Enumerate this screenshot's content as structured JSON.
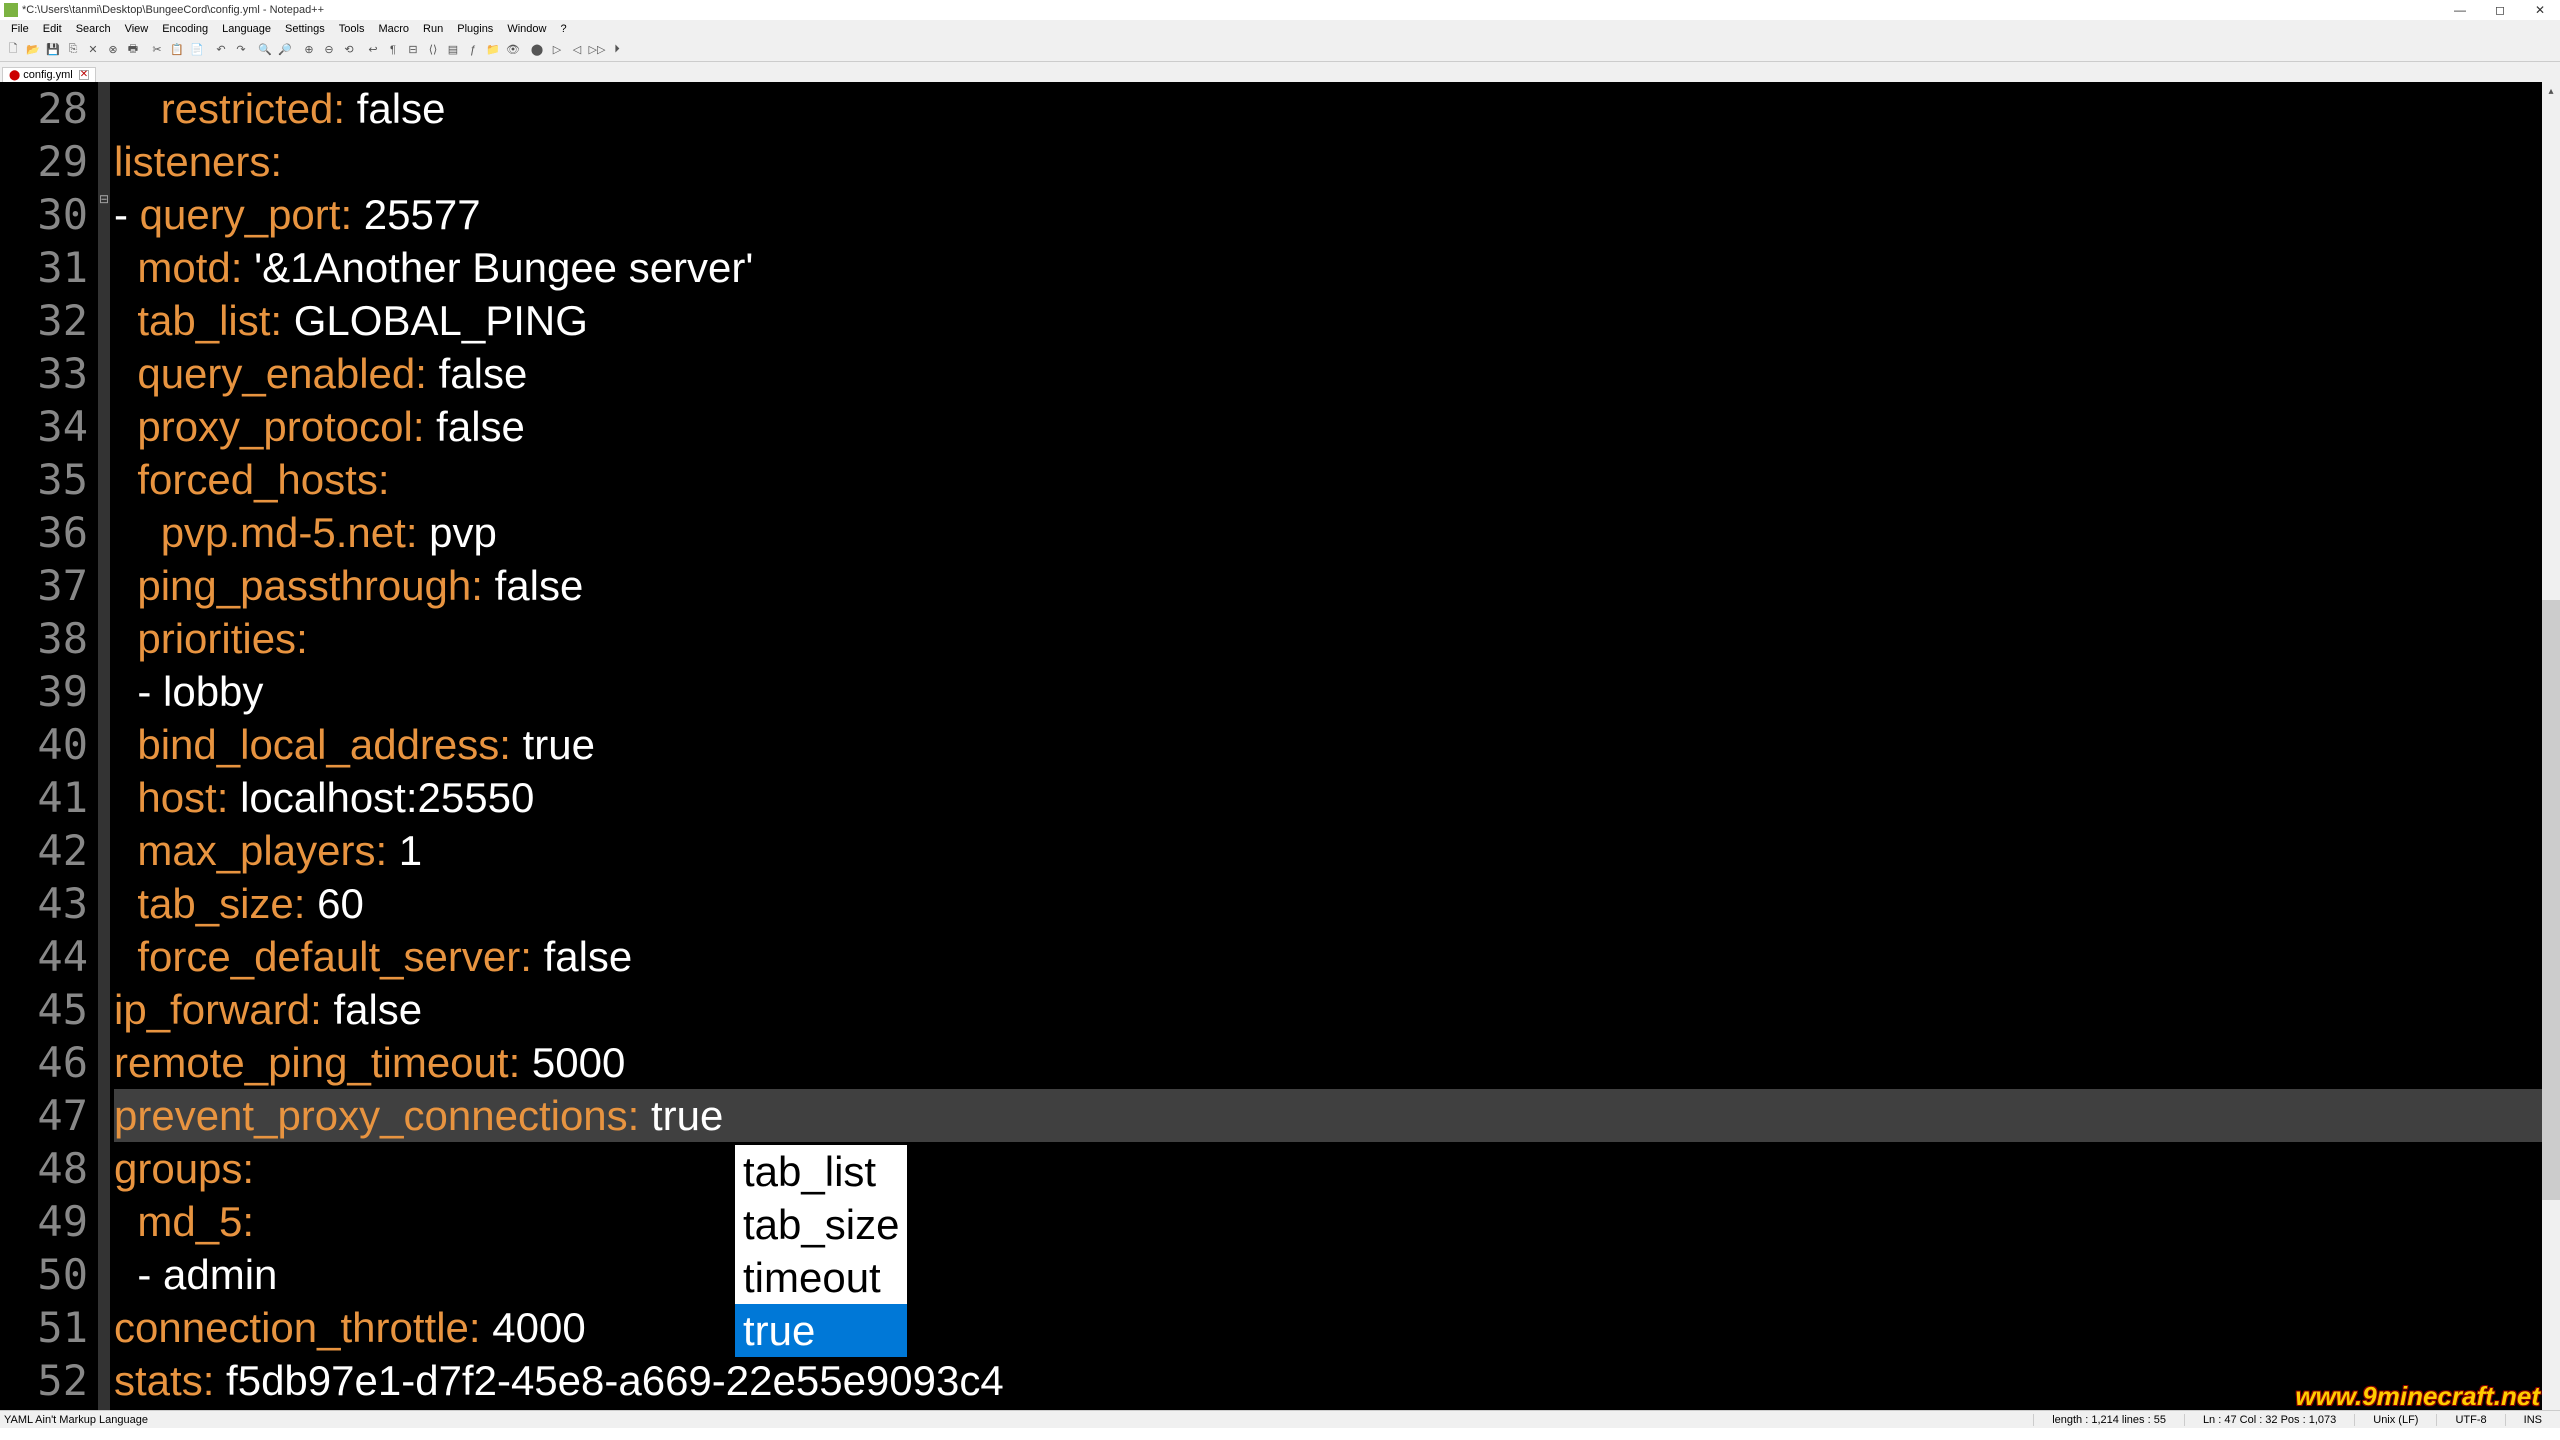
{
  "title": "*C:\\Users\\tanmi\\Desktop\\BungeeCord\\config.yml - Notepad++",
  "menu": [
    "File",
    "Edit",
    "Search",
    "View",
    "Encoding",
    "Language",
    "Settings",
    "Tools",
    "Macro",
    "Run",
    "Plugins",
    "Window",
    "?"
  ],
  "tab": {
    "name": "config.yml",
    "dirty": true
  },
  "lines": [
    {
      "n": 28,
      "indent": "    ",
      "key": "restricted",
      "sep": ": ",
      "val": "false",
      "vtype": "bool"
    },
    {
      "n": 29,
      "indent": "",
      "key": "listeners",
      "sep": ":",
      "val": "",
      "vtype": "none"
    },
    {
      "n": 30,
      "indent": "",
      "dash": "- ",
      "key": "query_port",
      "sep": ": ",
      "val": "25577",
      "vtype": "num"
    },
    {
      "n": 31,
      "indent": "  ",
      "key": "motd",
      "sep": ": ",
      "val": "'&1Another Bungee server'",
      "vtype": "str"
    },
    {
      "n": 32,
      "indent": "  ",
      "key": "tab_list",
      "sep": ": ",
      "val": "GLOBAL_PING",
      "vtype": "str"
    },
    {
      "n": 33,
      "indent": "  ",
      "key": "query_enabled",
      "sep": ": ",
      "val": "false",
      "vtype": "bool"
    },
    {
      "n": 34,
      "indent": "  ",
      "key": "proxy_protocol",
      "sep": ": ",
      "val": "false",
      "vtype": "bool"
    },
    {
      "n": 35,
      "indent": "  ",
      "key": "forced_hosts",
      "sep": ":",
      "val": "",
      "vtype": "none"
    },
    {
      "n": 36,
      "indent": "    ",
      "key": "pvp.md-5.net",
      "sep": ": ",
      "val": "pvp",
      "vtype": "str"
    },
    {
      "n": 37,
      "indent": "  ",
      "key": "ping_passthrough",
      "sep": ": ",
      "val": "false",
      "vtype": "bool"
    },
    {
      "n": 38,
      "indent": "  ",
      "key": "priorities",
      "sep": ":",
      "val": "",
      "vtype": "none"
    },
    {
      "n": 39,
      "indent": "  ",
      "dash": "- ",
      "val": "lobby",
      "vtype": "str"
    },
    {
      "n": 40,
      "indent": "  ",
      "key": "bind_local_address",
      "sep": ": ",
      "val": "true",
      "vtype": "bool"
    },
    {
      "n": 41,
      "indent": "  ",
      "key": "host",
      "sep": ": ",
      "val": "localhost:25550",
      "vtype": "str"
    },
    {
      "n": 42,
      "indent": "  ",
      "key": "max_players",
      "sep": ": ",
      "val": "1",
      "vtype": "num"
    },
    {
      "n": 43,
      "indent": "  ",
      "key": "tab_size",
      "sep": ": ",
      "val": "60",
      "vtype": "num"
    },
    {
      "n": 44,
      "indent": "  ",
      "key": "force_default_server",
      "sep": ": ",
      "val": "false",
      "vtype": "bool"
    },
    {
      "n": 45,
      "indent": "",
      "key": "ip_forward",
      "sep": ": ",
      "val": "false",
      "vtype": "bool"
    },
    {
      "n": 46,
      "indent": "",
      "key": "remote_ping_timeout",
      "sep": ": ",
      "val": "5000",
      "vtype": "num"
    },
    {
      "n": 47,
      "indent": "",
      "key": "prevent_proxy_connections",
      "sep": ": ",
      "val": "true",
      "vtype": "bool",
      "active": true
    },
    {
      "n": 48,
      "indent": "",
      "key": "groups",
      "sep": ":",
      "val": "",
      "vtype": "none"
    },
    {
      "n": 49,
      "indent": "  ",
      "key": "md_5",
      "sep": ":",
      "val": "",
      "vtype": "none"
    },
    {
      "n": 50,
      "indent": "  ",
      "dash": "- ",
      "val": "admin",
      "vtype": "str"
    },
    {
      "n": 51,
      "indent": "",
      "key": "connection_throttle",
      "sep": ": ",
      "val": "4000",
      "vtype": "num"
    },
    {
      "n": 52,
      "indent": "",
      "key": "stats",
      "sep": ": ",
      "val": "f5db97e1-d7f2-45e8-a669-22e55e9093c4",
      "vtype": "str"
    }
  ],
  "autocomplete": {
    "items": [
      "tab_list",
      "tab_size",
      "timeout",
      "true"
    ],
    "selected": 3
  },
  "status": {
    "lang": "YAML Ain't Markup Language",
    "length": "length : 1,214    lines : 55",
    "pos": "Ln : 47    Col : 32    Pos : 1,073",
    "eol": "Unix (LF)",
    "enc": "UTF-8",
    "ins": "INS"
  },
  "watermark": "www.9minecraft.net"
}
